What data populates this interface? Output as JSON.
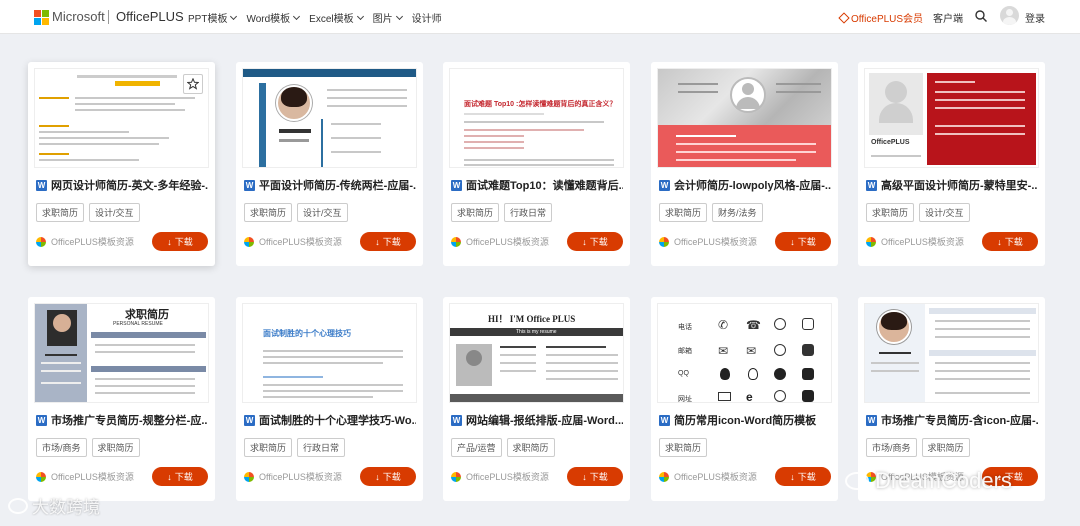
{
  "header": {
    "brand": "Microsoft",
    "product": "OfficePLUS",
    "nav": [
      "PPT模板",
      "Word模板",
      "Excel模板",
      "图片",
      "设计师"
    ],
    "member_label": "OfficePLUS会员",
    "client_label": "客户端",
    "login_label": "登录"
  },
  "colors": {
    "accent": "#d83b01",
    "member": "#d83b01",
    "word_badge": "#2b6cc4",
    "ms_red": "#f25022",
    "ms_green": "#7fba00",
    "ms_blue": "#00a4ef",
    "ms_yellow": "#ffb900"
  },
  "cards": [
    {
      "title": "网页设计师简历-英文-多年经验-...",
      "tags": [
        "求职简历",
        "设计/交互"
      ],
      "source": "OfficePLUS模板资源",
      "download": "下载",
      "badge": "W"
    },
    {
      "title": "平面设计师简历-传统两栏-应届-...",
      "tags": [
        "求职简历",
        "设计/交互"
      ],
      "source": "OfficePLUS模板资源",
      "download": "下载",
      "badge": "W"
    },
    {
      "title": "面试难题Top10：读懂难题背后...",
      "tags": [
        "求职简历",
        "行政日常"
      ],
      "source": "OfficePLUS模板资源",
      "download": "下载",
      "badge": "W",
      "thumb_heading": "面试难题 Top10 :怎样读懂难题背后的真正含义？"
    },
    {
      "title": "会计师简历-lowpoly风格-应届-...",
      "tags": [
        "求职简历",
        "财务/法务"
      ],
      "source": "OfficePLUS模板资源",
      "download": "下载",
      "badge": "W"
    },
    {
      "title": "高级平面设计师简历-蒙特里安-...",
      "tags": [
        "求职简历",
        "设计/交互"
      ],
      "source": "OfficePLUS模板资源",
      "download": "下载",
      "badge": "W",
      "thumb_name": "OfficePLUS"
    },
    {
      "title": "市场推广专员简历-规整分栏-应...",
      "tags": [
        "市场/商务",
        "求职简历"
      ],
      "source": "OfficePLUS模板资源",
      "download": "下载",
      "badge": "W",
      "thumb_heading": "求职简历",
      "thumb_sub": "PERSONAL    RESUME"
    },
    {
      "title": "面试制胜的十个心理学技巧-Wo...",
      "tags": [
        "求职简历",
        "行政日常"
      ],
      "source": "OfficePLUS模板资源",
      "download": "下载",
      "badge": "W",
      "thumb_heading": "面试制胜的十个心理技巧"
    },
    {
      "title": "网站编辑-报纸排版-应届-Word...",
      "tags": [
        "产品/运营",
        "求职简历"
      ],
      "source": "OfficePLUS模板资源",
      "download": "下载",
      "badge": "W",
      "thumb_heading": "HI！ I'M Office PLUS",
      "thumb_sub": "This is my resume"
    },
    {
      "title": "简历常用icon-Word简历模板",
      "tags": [
        "求职简历"
      ],
      "source": "OfficePLUS模板资源",
      "download": "下载",
      "badge": "W",
      "thumb_labels": [
        "电话",
        "邮箱",
        "QQ",
        "网址"
      ]
    },
    {
      "title": "市场推广专员简历-含icon-应届-...",
      "tags": [
        "市场/商务",
        "求职简历"
      ],
      "source": "OfficePLUS模板资源",
      "download": "下载",
      "badge": "W"
    }
  ],
  "watermarks": {
    "left": "大数跨境",
    "right": "DreamCoders"
  }
}
